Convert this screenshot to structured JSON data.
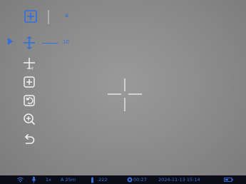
{
  "top_bar": {
    "mode_icon": "frame-plus-icon",
    "value": "a"
  },
  "selected_item": {
    "icon": "crosshair-move-icon",
    "value": "10"
  },
  "menu": [
    {
      "name": "crosshair-adjust-icon",
      "label": ""
    },
    {
      "name": "add-frame-icon",
      "label": ""
    },
    {
      "name": "reset-frame-icon",
      "label": ""
    },
    {
      "name": "zoom-in-icon",
      "label": ""
    },
    {
      "name": "back-icon",
      "label": ""
    }
  ],
  "statusbar": {
    "wifi_icon": "wifi-icon",
    "mic_icon": "microphone-icon",
    "zoom": "1x",
    "range": "A 25m",
    "gun_icon": "cartridge-icon",
    "caliber": ".222",
    "timer_icon": "record-icon",
    "timer": "00:27",
    "datetime": "2024-11-13  15:14",
    "battery_icon": "battery-icon"
  },
  "colors": {
    "accent": "#2f6fe0",
    "bar": "#0a0d18",
    "background": "#8d8d8d"
  }
}
